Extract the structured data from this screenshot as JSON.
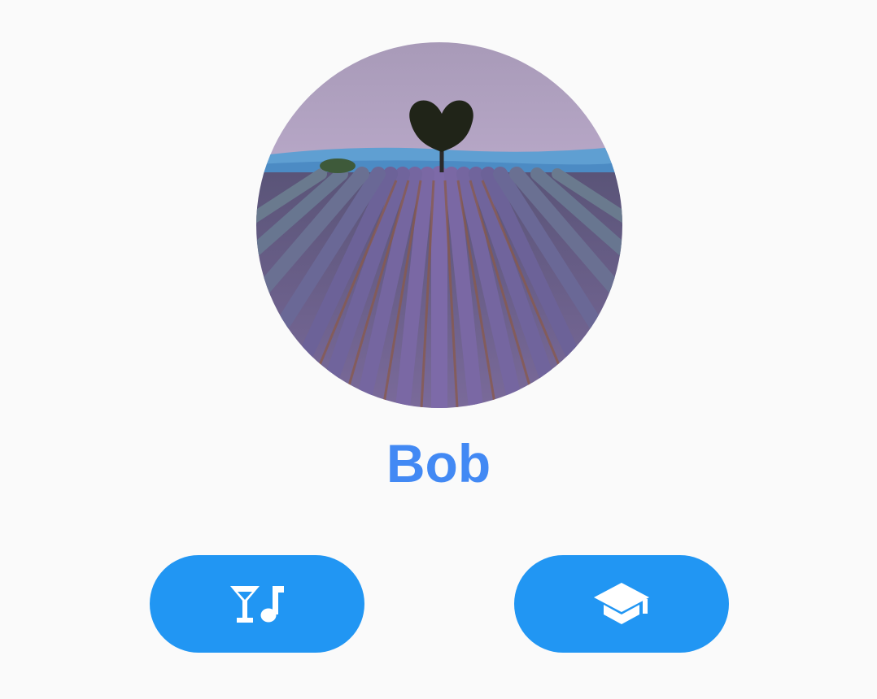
{
  "profile": {
    "name": "Bob",
    "avatar_description": "lavender-field-photo"
  },
  "actions": [
    {
      "icon": "nightlife-icon"
    },
    {
      "icon": "school-icon"
    }
  ],
  "colors": {
    "accent": "#4289f4",
    "button": "#2196f3",
    "background": "#fafafa"
  }
}
